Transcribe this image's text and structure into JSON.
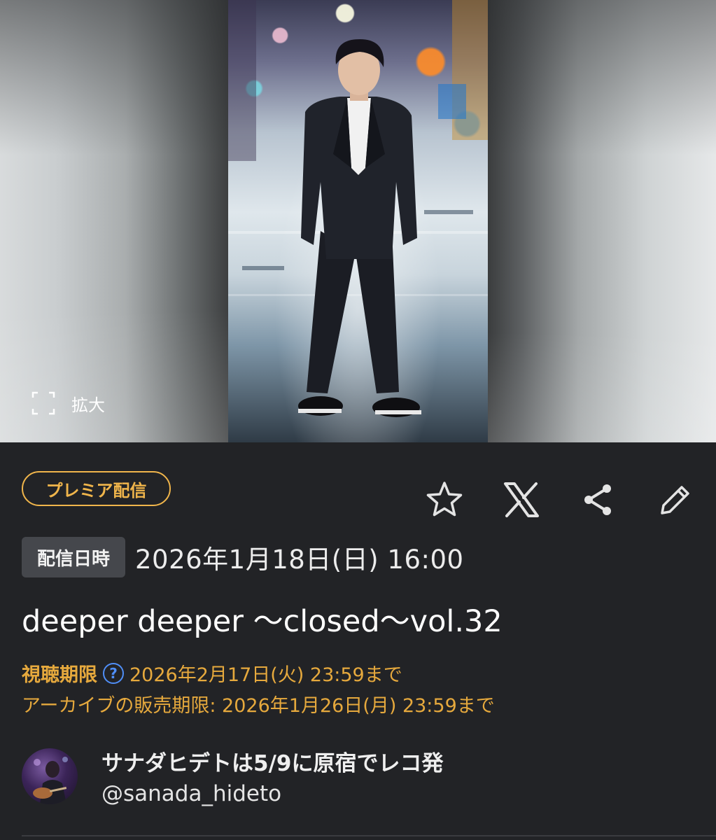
{
  "hero": {
    "expand_label": "拡大"
  },
  "badge": {
    "label": "プレミア配信",
    "color": "#f0b54b"
  },
  "actions": [
    {
      "name": "favorite",
      "icon": "star-outline-icon"
    },
    {
      "name": "share-x",
      "icon": "x-logo-icon"
    },
    {
      "name": "share",
      "icon": "share-icon"
    },
    {
      "name": "edit",
      "icon": "pencil-icon"
    }
  ],
  "schedule": {
    "chip_label": "配信日時",
    "datetime": "2026年1月18日(日) 16:00"
  },
  "event": {
    "title": "deeper deeper ～closed～vol.32"
  },
  "viewing": {
    "label": "視聴期限",
    "deadline": "2026年2月17日(火) 23:59まで",
    "accent_color": "#e6a93d",
    "help_color": "#4f8ef7"
  },
  "archive": {
    "sale_text": "アーカイブの販売期限: 2026年1月26日(月) 23:59まで"
  },
  "creator": {
    "name": "サナダヒデトは5/9に原宿でレコ発",
    "handle": "@sanada_hideto"
  }
}
